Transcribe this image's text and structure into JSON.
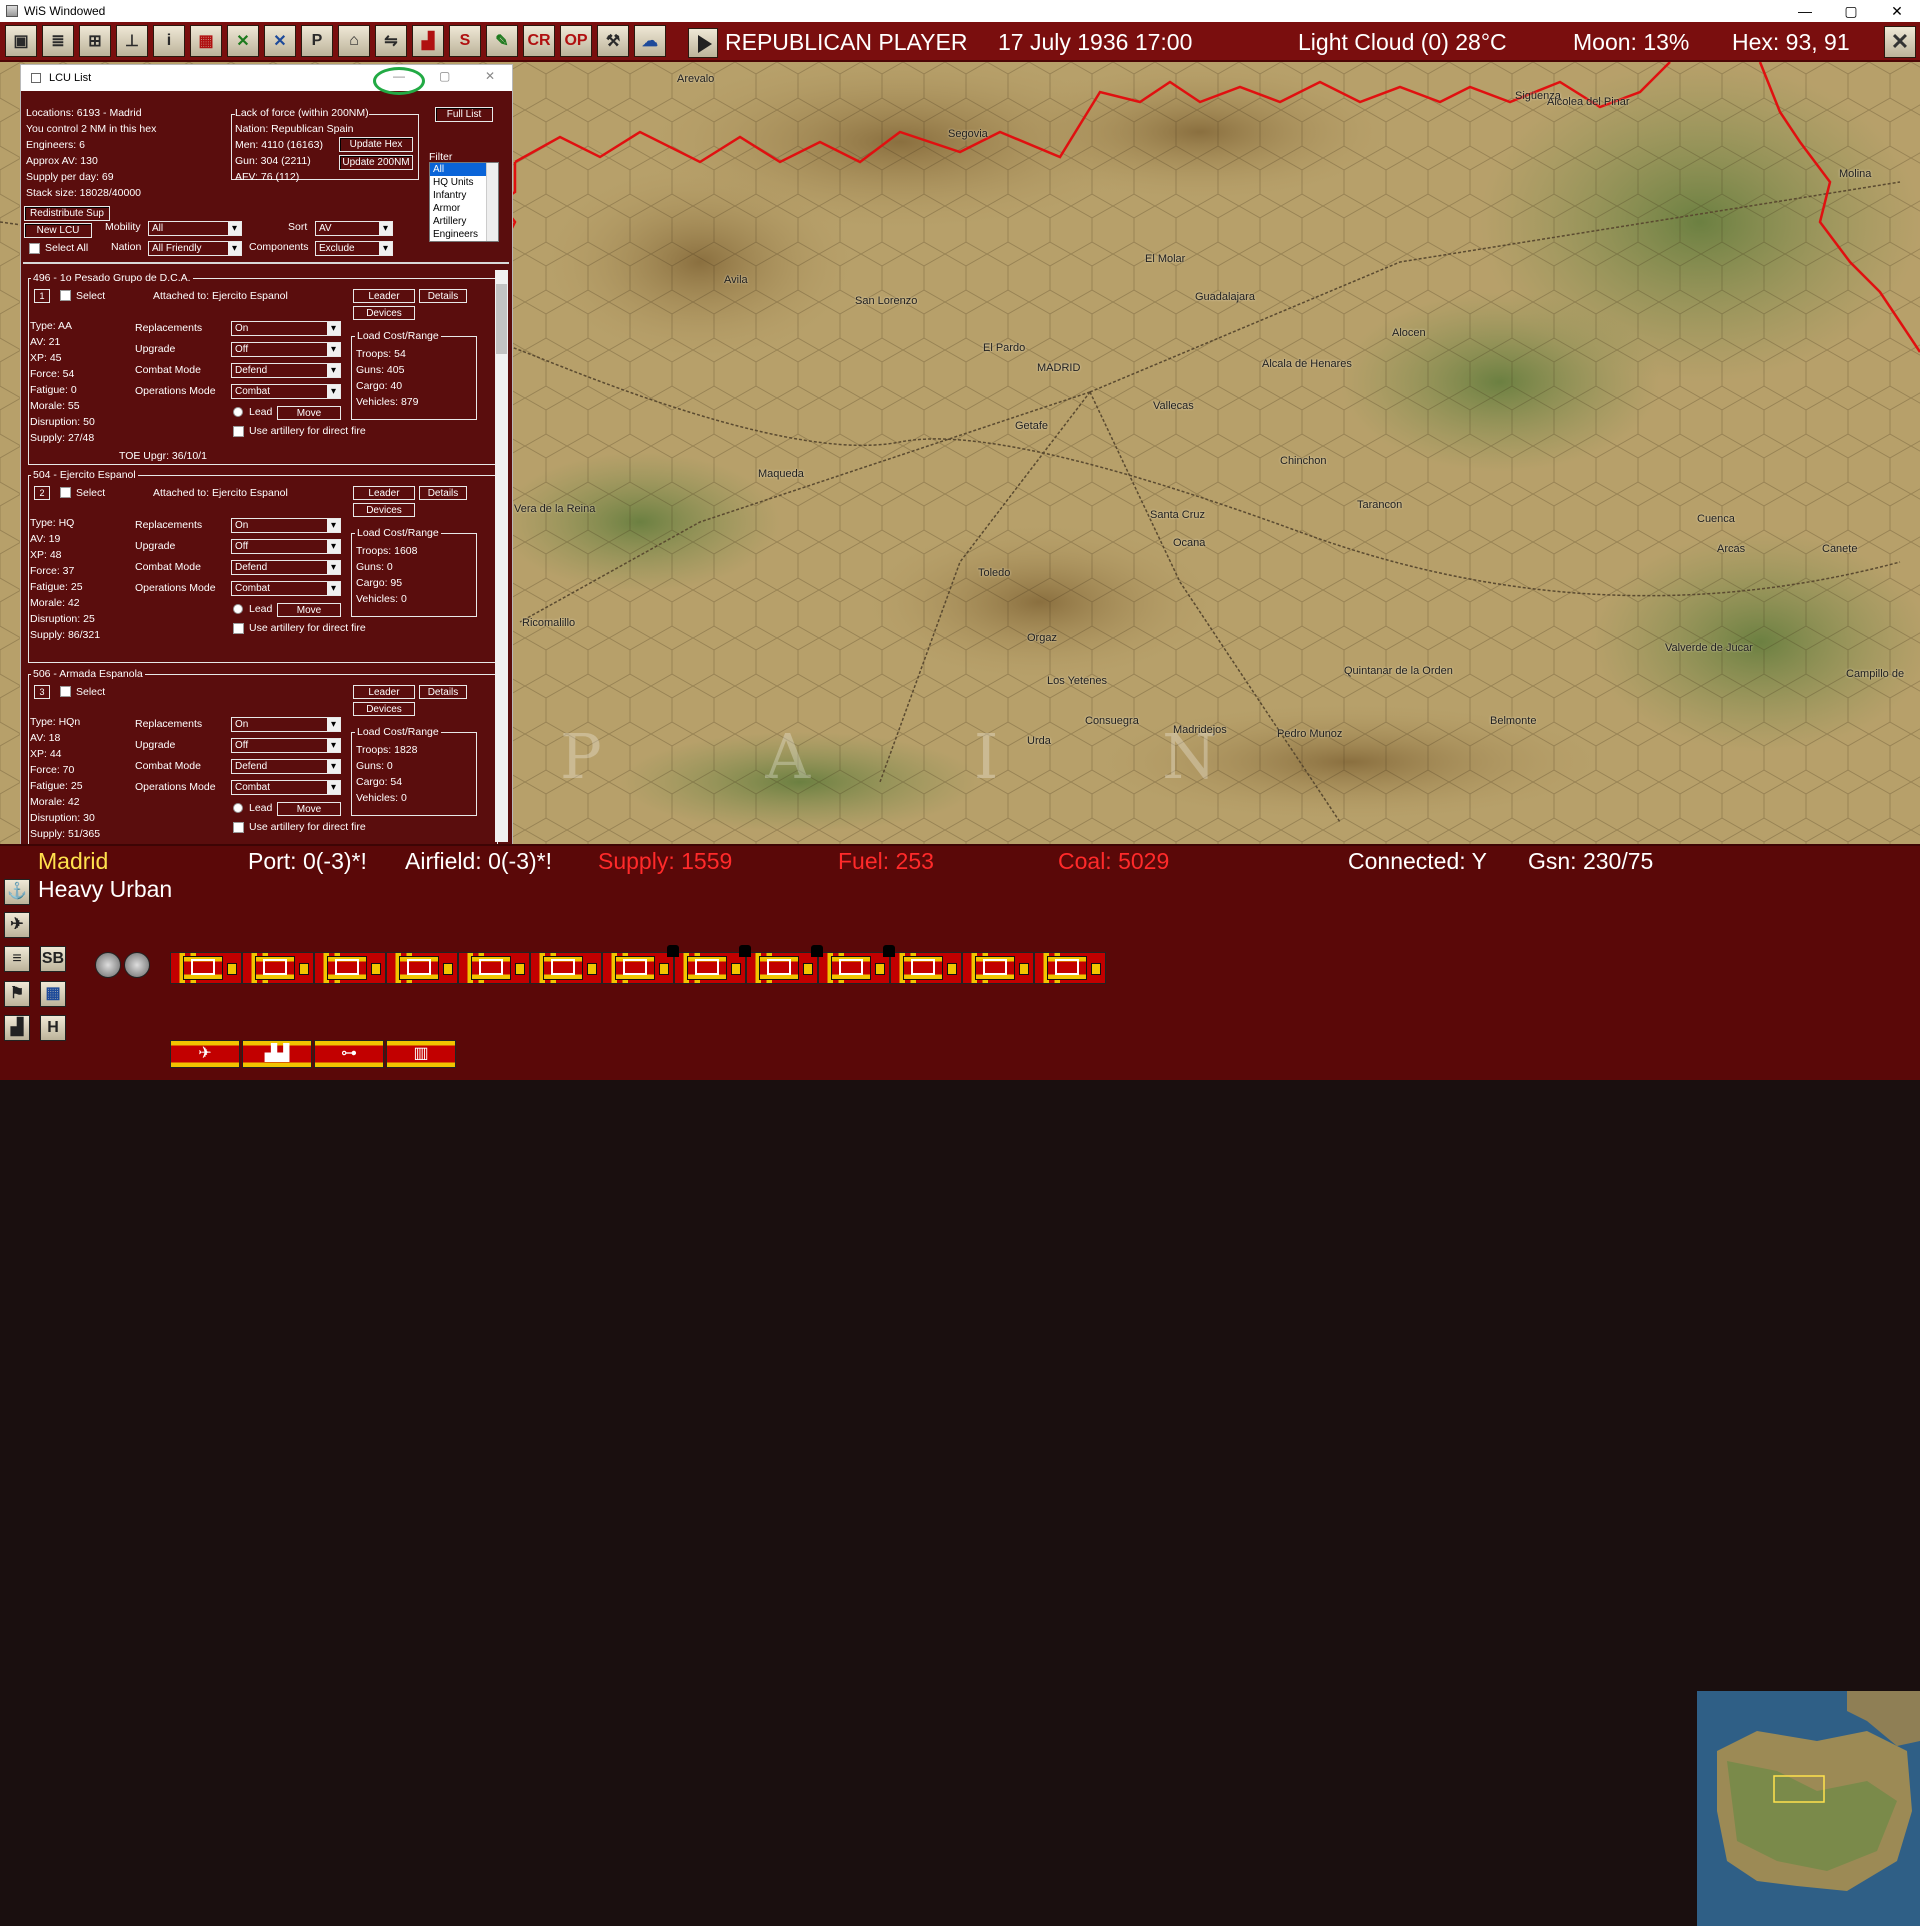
{
  "window": {
    "title": "WiS Windowed",
    "min": "—",
    "max": "▢",
    "close": "✕"
  },
  "toolbar": {
    "buttons": [
      "save-icon",
      "list-icon",
      "tree-icon",
      "ledger-icon",
      "info-icon",
      "color-map-icon",
      "green-cross-icon",
      "blue-cross-icon",
      "flag-icon",
      "terrain-icon",
      "rail-icon",
      "factory-icon",
      "supply-icon",
      "pencil-icon",
      "cr-icon",
      "op-icon",
      "tools-icon",
      "weather-icon"
    ],
    "labels": [
      "▣",
      "≣",
      "⊞",
      "⊥",
      "i",
      "▦",
      "✕",
      "✕",
      "P",
      "⌂",
      "⇋",
      "▟",
      "S",
      "✎",
      "CR",
      "OP",
      "⚒",
      "☁"
    ],
    "player": "REPUBLICAN PLAYER",
    "date": "17 July 1936 17:00",
    "weather": "Light Cloud (0) 28°C",
    "moon": "Moon: 13%",
    "hex": "Hex: 93, 91",
    "end_turn": "✕"
  },
  "lcu": {
    "title": "LCU List",
    "info": [
      "Locations: 6193 - Madrid",
      "You control 2 NM in this hex",
      "Engineers: 6",
      "Approx AV: 130",
      "Supply per day: 69",
      "Stack size: 18028/40000"
    ],
    "lack": {
      "header": "Lack of force (within 200NM)",
      "nation": "Nation: Republican Spain",
      "men": "Men: 4110 (16163)",
      "gun": "Gun: 304 (2211)",
      "afv": "AFV: 76 (112)",
      "update_hex": "Update Hex",
      "update_200": "Update 200NM"
    },
    "full_list": "Full List",
    "filter_label": "Filter",
    "filter_options": [
      "All",
      "HQ Units",
      "Infantry",
      "Armor",
      "Artillery",
      "Engineers"
    ],
    "redistribute": "Redistribute Sup",
    "new_lcu": "New LCU",
    "select_all": "Select All",
    "mobility_label": "Mobility",
    "mobility": "All",
    "nation_label": "Nation",
    "nation": "All Friendly",
    "sort_label": "Sort",
    "sort": "AV",
    "components_label": "Components",
    "components": "Exclude",
    "field_labels": {
      "replacements": "Replacements",
      "upgrade": "Upgrade",
      "combat": "Combat Mode",
      "ops": "Operations Mode",
      "lead": "Lead",
      "move": "Move",
      "direct": "Use artillery for direct fire",
      "load": "Load Cost/Range",
      "leader": "Leader",
      "details": "Details",
      "devices": "Devices",
      "select": "Select"
    },
    "units": [
      {
        "header": "496 - 1o Pesado Grupo de D.C.A.",
        "num": "1",
        "attached": "Attached to: Ejercito Espanol",
        "stats": [
          "Type: AA",
          "AV: 21",
          "XP: 45",
          "Force: 54",
          "Fatigue: 0",
          "Morale: 55",
          "Disruption: 50",
          "Supply: 27/48"
        ],
        "repl": "On",
        "upgrade": "Off",
        "combat": "Defend",
        "ops": "Combat",
        "load": [
          "Troops: 54",
          "Guns: 405",
          "Cargo: 40",
          "Vehicles: 879"
        ],
        "toe": "TOE Upgr: 36/10/1"
      },
      {
        "header": "504 - Ejercito Espanol",
        "num": "2",
        "attached": "Attached to: Ejercito Espanol",
        "stats": [
          "Type: HQ",
          "AV: 19",
          "XP: 48",
          "Force: 37",
          "Fatigue: 25",
          "Morale: 42",
          "Disruption: 25",
          "Supply: 86/321"
        ],
        "repl": "On",
        "upgrade": "Off",
        "combat": "Defend",
        "ops": "Combat",
        "load": [
          "Troops: 1608",
          "Guns: 0",
          "Cargo: 95",
          "Vehicles: 0"
        ],
        "toe": ""
      },
      {
        "header": "506 - Armada Espanola",
        "num": "3",
        "attached": "",
        "stats": [
          "Type: HQn",
          "AV: 18",
          "XP: 44",
          "Force: 70",
          "Fatigue: 25",
          "Morale: 42",
          "Disruption: 30",
          "Supply: 51/365"
        ],
        "repl": "On",
        "upgrade": "Off",
        "combat": "Defend",
        "ops": "Combat",
        "load": [
          "Troops: 1828",
          "Guns: 0",
          "Cargo: 54",
          "Vehicles: 0"
        ],
        "toe": ""
      }
    ]
  },
  "map": {
    "cities": [
      "Segovia",
      "Sigüenza",
      "Arevalo",
      "Molina",
      "Avila",
      "San Lorenzo",
      "El Molar",
      "Guadalajara",
      "Alocen",
      "El Pardo",
      "MADRID",
      "Alcala de Henares",
      "Vallecas",
      "Getafe",
      "Chinchon",
      "Maqueda",
      "Santa Cruz",
      "Ocana",
      "Tarancon",
      "Cuenca",
      "Arcas",
      "Canete",
      "Vera de la Reina",
      "Toledo",
      "Ricomalillo",
      "Orgaz",
      "Los Yetenes",
      "Quintanar de la Orden",
      "Valverde de Jucar",
      "Campillo de",
      "Consuegra",
      "Madridejos",
      "Belmonte",
      "Urda",
      "Pedro Munoz",
      "Alcolea del Pinar"
    ],
    "region": "P A I N"
  },
  "bottom": {
    "location": "Madrid",
    "terrain": "Heavy Urban",
    "port": "Port: 0(-3)*!",
    "airfield": "Airfield: 0(-3)*!",
    "supply": "Supply: 1559",
    "fuel": "Fuel: 253",
    "coal": "Coal: 5029",
    "connected": "Connected: Y",
    "gsn": "Gsn: 230/75",
    "sb": "SB",
    "h": "H",
    "colors": {
      "accent_red": "#ff2a2a",
      "label_yellow": "#ffe14d"
    }
  }
}
